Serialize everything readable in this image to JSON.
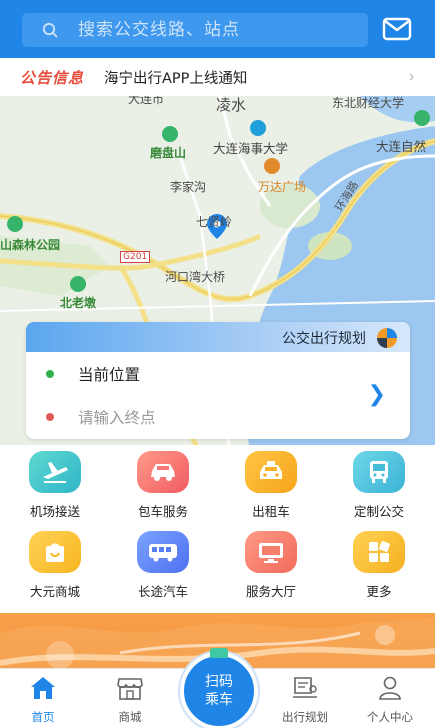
{
  "search": {
    "placeholder": "搜索公交线路、站点"
  },
  "notice": {
    "badge": "公告信息",
    "text": "海宁出行APP上线通知"
  },
  "map": {
    "labels": [
      "大连市",
      "凌水",
      "东北财经大学",
      "大连海事大学",
      "大连自然",
      "磨盘山",
      "李家沟",
      "万达广场",
      "七贤岭",
      "环海路",
      "山森林公园",
      "G201",
      "河口湾大桥",
      "北老墩"
    ]
  },
  "plan": {
    "title": "公交出行规划",
    "current": "当前位置",
    "destination_placeholder": "请输入终点"
  },
  "services": [
    {
      "label": "机场接送",
      "icon": "airport-shuttle-icon"
    },
    {
      "label": "包车服务",
      "icon": "charter-car-icon"
    },
    {
      "label": "出租车",
      "icon": "taxi-icon"
    },
    {
      "label": "定制公交",
      "icon": "custom-bus-icon"
    },
    {
      "label": "大元商城",
      "icon": "shopping-bag-icon"
    },
    {
      "label": "长途汽车",
      "icon": "coach-bus-icon"
    },
    {
      "label": "服务大厅",
      "icon": "service-hall-icon"
    },
    {
      "label": "更多",
      "icon": "more-grid-icon"
    }
  ],
  "tabs": [
    {
      "label": "首页"
    },
    {
      "label": "商城"
    },
    {
      "label": "出行规划"
    },
    {
      "label": "个人中心"
    }
  ],
  "scan": {
    "line1": "扫码",
    "line2": "乘车"
  },
  "colors": {
    "primary": "#1f86e8",
    "notice": "#e74c3c",
    "banner": "#f5913c"
  }
}
